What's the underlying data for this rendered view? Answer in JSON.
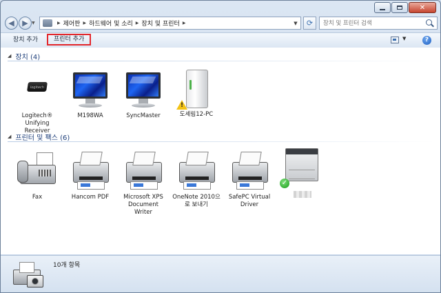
{
  "window": {
    "caption_buttons": [
      "minimize",
      "maximize",
      "close"
    ]
  },
  "address_bar": {
    "breadcrumbs": [
      "제어판",
      "하드웨어 및 소리",
      "장치 및 프린터"
    ]
  },
  "search": {
    "placeholder": "장치 및 프린터 검색"
  },
  "toolbar": {
    "add_device": "장치 추가",
    "add_printer": "프린터 추가",
    "highlight_color": "#e3262b"
  },
  "groups": {
    "devices": {
      "title": "장치 (4)",
      "items": [
        {
          "label": "Logitech® Unifying Receiver",
          "icon": "usb-receiver-icon"
        },
        {
          "label": "M198WA",
          "icon": "monitor-icon"
        },
        {
          "label": "SyncMaster",
          "icon": "monitor-icon"
        },
        {
          "label": "도세림12-PC",
          "icon": "computer-icon",
          "badge": "warning-icon"
        }
      ]
    },
    "printers": {
      "title": "프린터 및 팩스 (6)",
      "items": [
        {
          "label": "Fax",
          "icon": "fax-icon"
        },
        {
          "label": "Hancom PDF",
          "icon": "printer-icon"
        },
        {
          "label": "Microsoft XPS Document Writer",
          "icon": "printer-icon"
        },
        {
          "label": "OneNote 2010으로 보내기",
          "icon": "printer-icon"
        },
        {
          "label": "SafePC Virtual Driver",
          "icon": "printer-icon"
        },
        {
          "label": "",
          "icon": "laser-printer-icon",
          "badge": "default-check-icon"
        }
      ]
    }
  },
  "status": {
    "count": "10개 항목"
  }
}
